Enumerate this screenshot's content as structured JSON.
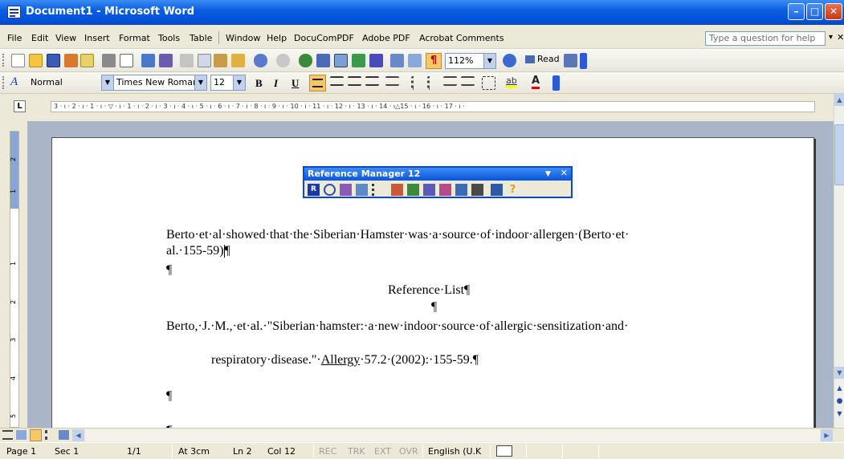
{
  "window": {
    "title": "Document1 - Microsoft Word",
    "minimize_glyph": "–",
    "maximize_glyph": "□",
    "close_glyph": "✕"
  },
  "menubar": {
    "items": [
      "File",
      "Edit",
      "View",
      "Insert",
      "Format",
      "Tools",
      "Table",
      "Window",
      "Help",
      "DocuComPDF",
      "Adobe PDF",
      "Acrobat Comments"
    ],
    "help_placeholder": "Type a question for help",
    "help_arrow": "▾",
    "close_doc": "✕"
  },
  "toolbar_standard": {
    "zoom": "112%",
    "read_label": "Read",
    "pilcrow": "¶"
  },
  "toolbar_formatting": {
    "style": "Normal",
    "font": "Times New Roman",
    "size": "12",
    "bold": "B",
    "italic": "I",
    "underline": "U",
    "highlight_label": "ab",
    "font_color_label": "A",
    "style_icon": "A"
  },
  "ruler": {
    "tab_selector": "L",
    "ticks": "3 · ı · 2 · ı · 1 · ı · ▽ · ı · 1 · ı · 2 · ı · 3 · ı · 4 · ı · 5 · ı · 6 · ı · 7 · ı · 8 · ı · 9 · ı · 10 · ı · 11 · ı · 12 · ı · 13 · ı · 14 · ı△15 · ı · 16 · ı · 17 · ı ·"
  },
  "vertical_ruler": {
    "labels": [
      "2",
      "1",
      "1",
      "2",
      "3",
      "4",
      "5"
    ]
  },
  "reference_manager": {
    "title": "Reference Manager 12",
    "dropdown_glyph": "▼",
    "close_glyph": "✕",
    "icons": [
      "rm-logo",
      "search",
      "edit-citation",
      "tools",
      "bibliography",
      "annotate",
      "insert",
      "generate",
      "format",
      "import",
      "export",
      "sync",
      "help"
    ]
  },
  "document": {
    "para1_line1": "Berto·et·al·showed·that·the·Siberian·Hamster·was·a·source·of·indoor·allergen·(Berto·et·",
    "para1_line2": "al.·155-59)",
    "pilcrow": "¶",
    "heading": "Reference·List¶",
    "ref_line1": "Berto,·J.·M.,·et·al.·\"Siberian·hamster:·a·new·indoor·source·of·allergic·sensitization·and·",
    "ref_line2_pre": "respiratory·disease.\"·",
    "ref_line2_journal": "Allergy",
    "ref_line2_post": "·57.2·(2002):·155-59.¶"
  },
  "statusbar": {
    "page": "Page 1",
    "sec": "Sec 1",
    "pages": "1/1",
    "at": "At 3cm",
    "ln": "Ln 2",
    "col": "Col 12",
    "rec": "REC",
    "trk": "TRK",
    "ext": "EXT",
    "ovr": "OVR",
    "language": "English (U.K"
  },
  "colors": {
    "titlebar": "#0a5ee0",
    "chrome": "#ece9d8",
    "doc_bg": "#aab5c8"
  }
}
